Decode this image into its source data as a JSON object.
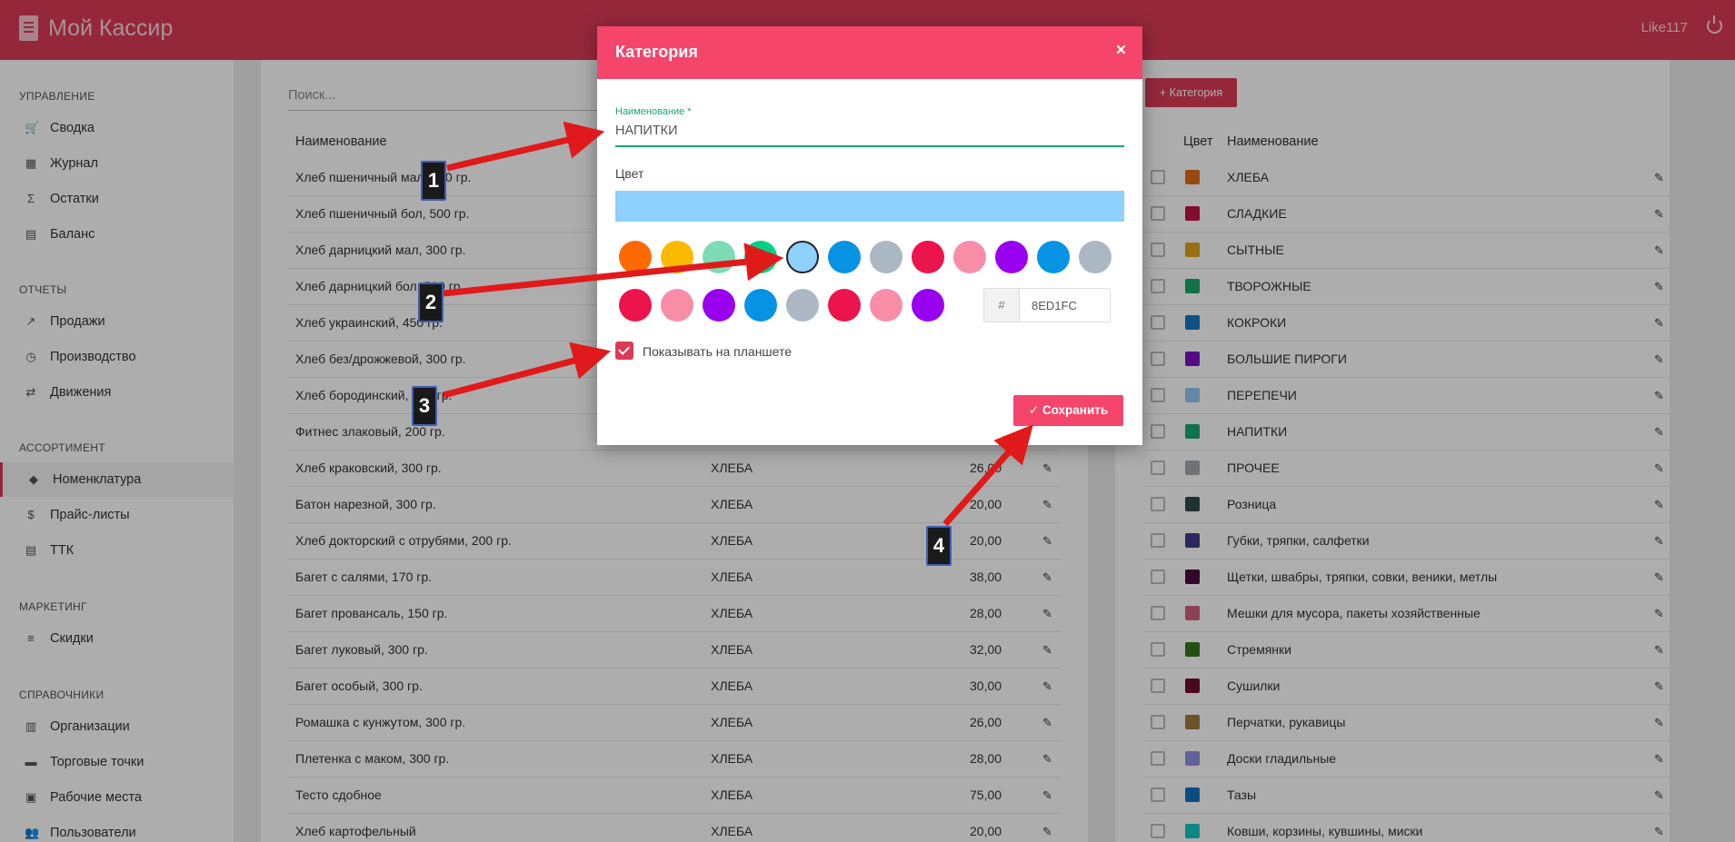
{
  "header": {
    "app_title": "Мой Кассир",
    "user": "Like117"
  },
  "sidebar": {
    "sections": [
      {
        "title": "УПРАВЛЕНИЕ",
        "items": [
          {
            "label": "Сводка",
            "icon": "cart-icon"
          },
          {
            "label": "Журнал",
            "icon": "calendar-icon"
          },
          {
            "label": "Остатки",
            "icon": "sigma-icon"
          },
          {
            "label": "Баланс",
            "icon": "book-icon"
          }
        ]
      },
      {
        "title": "ОТЧЕТЫ",
        "items": [
          {
            "label": "Продажи",
            "icon": "trend-icon"
          },
          {
            "label": "Производство",
            "icon": "timer-icon"
          },
          {
            "label": "Движения",
            "icon": "swap-icon"
          }
        ]
      },
      {
        "title": "АССОРТИМЕНТ",
        "items": [
          {
            "label": "Номенклатура",
            "icon": "tag-icon"
          },
          {
            "label": "Прайс-листы",
            "icon": "dollar-icon"
          },
          {
            "label": "ТТК",
            "icon": "book-icon"
          }
        ]
      },
      {
        "title": "МАРКЕТИНГ",
        "items": [
          {
            "label": "Скидки",
            "icon": "list-icon"
          }
        ]
      },
      {
        "title": "СПРАВОЧНИКИ",
        "items": [
          {
            "label": "Организации",
            "icon": "building-icon"
          },
          {
            "label": "Торговые точки",
            "icon": "store-icon"
          },
          {
            "label": "Рабочие места",
            "icon": "workplace-icon"
          },
          {
            "label": "Пользователи",
            "icon": "users-icon"
          }
        ]
      }
    ]
  },
  "products": {
    "search_placeholder": "Поиск...",
    "column_name": "Наименование",
    "rows": [
      {
        "name": "Хлеб пшеничный мал, 300 гр.",
        "category": "",
        "price": ""
      },
      {
        "name": "Хлеб пшеничный бол, 500 гр.",
        "category": "",
        "price": ""
      },
      {
        "name": "Хлеб дарницкий мал, 300 гр.",
        "category": "",
        "price": ""
      },
      {
        "name": "Хлеб дарницкий бол, 500 гр.",
        "category": "",
        "price": ""
      },
      {
        "name": "Хлеб украинский, 450 гр.",
        "category": "",
        "price": ""
      },
      {
        "name": "Хлеб без/дрожжевой, 300 гр.",
        "category": "",
        "price": ""
      },
      {
        "name": "Хлеб бородинский, 300 гр.",
        "category": "",
        "price": ""
      },
      {
        "name": "Фитнес злаковый, 200 гр.",
        "category": "",
        "price": ""
      },
      {
        "name": "Хлеб краковский, 300 гр.",
        "category": "ХЛЕБА",
        "price": "26,00"
      },
      {
        "name": "Батон нарезной, 300 гр.",
        "category": "ХЛЕБА",
        "price": "20,00"
      },
      {
        "name": "Хлеб докторский с отрубями, 200 гр.",
        "category": "ХЛЕБА",
        "price": "20,00"
      },
      {
        "name": "Багет с салями, 170 гр.",
        "category": "ХЛЕБА",
        "price": "38,00"
      },
      {
        "name": "Багет провансаль, 150 гр.",
        "category": "ХЛЕБА",
        "price": "28,00"
      },
      {
        "name": "Багет луковый, 300 гр.",
        "category": "ХЛЕБА",
        "price": "32,00"
      },
      {
        "name": "Багет особый, 300 гр.",
        "category": "ХЛЕБА",
        "price": "30,00"
      },
      {
        "name": "Ромашка с кунжутом, 300 гр.",
        "category": "ХЛЕБА",
        "price": "26,00"
      },
      {
        "name": "Плетенка с маком, 300 гр.",
        "category": "ХЛЕБА",
        "price": "28,00"
      },
      {
        "name": "Тесто сдобное",
        "category": "ХЛЕБА",
        "price": "75,00"
      },
      {
        "name": "Хлеб картофельный",
        "category": "ХЛЕБА",
        "price": "20,00"
      }
    ]
  },
  "categories": {
    "add_button": "+ Категория",
    "column_color": "Цвет",
    "column_name": "Наименование",
    "rows": [
      {
        "name": "ХЛЕБА",
        "color": "#e36a12"
      },
      {
        "name": "СЛАДКИЕ",
        "color": "#c01441"
      },
      {
        "name": "СЫТНЫЕ",
        "color": "#e0a317"
      },
      {
        "name": "ТВОРОЖНЫЕ",
        "color": "#17a86b"
      },
      {
        "name": "КОКРОКИ",
        "color": "#1777c4"
      },
      {
        "name": "БОЛЬШИЕ ПИРОГИ",
        "color": "#7b12c6"
      },
      {
        "name": "ПЕРЕПЕЧИ",
        "color": "#8ecbf2"
      },
      {
        "name": "НАПИТКИ",
        "color": "#16a872"
      },
      {
        "name": "ПРОЧЕЕ",
        "color": "#a3aab2"
      },
      {
        "name": "Розница",
        "color": "#2f4a4f"
      },
      {
        "name": "Губки, тряпки, салфетки",
        "color": "#3f3d8a"
      },
      {
        "name": "Щетки, швабры, тряпки, совки, веники, метлы",
        "color": "#4a0b3c"
      },
      {
        "name": "Мешки для мусора, пакеты хозяйственные",
        "color": "#d06082"
      },
      {
        "name": "Стремянки",
        "color": "#2f7a1c"
      },
      {
        "name": "Сушилки",
        "color": "#6d0b2c"
      },
      {
        "name": "Перчатки, рукавицы",
        "color": "#a07a3a"
      },
      {
        "name": "Доски гладильные",
        "color": "#8c93e0"
      },
      {
        "name": "Тазы",
        "color": "#1170c4"
      },
      {
        "name": "Ковши, корзины, кувшины, миски",
        "color": "#17c6c6"
      }
    ]
  },
  "modal": {
    "title": "Категория",
    "close": "×",
    "name_label": "Наименование *",
    "name_value": "НАПИТКИ",
    "color_label": "Цвет",
    "selected_color": "#8ED1FC",
    "hex_prefix": "#",
    "hex_value": "8ED1FC",
    "palette_row1": [
      "#ff6900",
      "#fcb900",
      "#7bdcb5",
      "#00d084",
      "#8ed1fc",
      "#0693e3",
      "#abb8c3",
      "#eb144c",
      "#f78da7",
      "#9900ef",
      "#0693e3",
      "#abb8c3"
    ],
    "palette_row2": [
      "#eb144c",
      "#f78da7",
      "#9900ef",
      "#0693e3",
      "#abb8c3",
      "#eb144c",
      "#f78da7",
      "#9900ef"
    ],
    "show_on_tablet_label": "Показывать на планшете",
    "show_on_tablet": true,
    "save_button": "Сохранить"
  },
  "annotations": [
    "1",
    "2",
    "3",
    "4"
  ],
  "colors": {
    "brand": "#dc3a57",
    "modal_header": "#f5456b",
    "arrow": "#e01a1a",
    "focus": "#1aa27e"
  }
}
